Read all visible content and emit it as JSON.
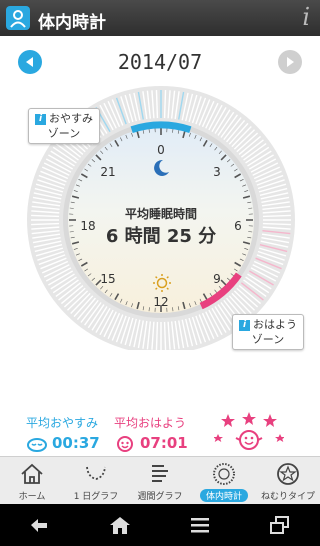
{
  "header": {
    "title": "体内時計",
    "info_glyph": "i"
  },
  "month": {
    "label": "2014/07"
  },
  "clock": {
    "hour_labels": [
      "0",
      "3",
      "6",
      "9",
      "12",
      "15",
      "18",
      "21"
    ],
    "center_title": "平均睡眠時間",
    "center_value": "6 時間 25 分",
    "sleep_zone_line1": "おやすみ",
    "sleep_zone_line2": "ゾーン",
    "wake_zone_line1": "おはよう",
    "wake_zone_line2": "ゾーン"
  },
  "stats": {
    "avg_sleep_label": "平均おやすみ",
    "avg_sleep_time": "00:37",
    "avg_wake_label": "平均おはよう",
    "avg_wake_time": "07:01"
  },
  "tabs": [
    {
      "label": "ホーム",
      "icon": "home-icon"
    },
    {
      "label": "1 日グラフ",
      "icon": "day-graph-icon"
    },
    {
      "label": "週間グラフ",
      "icon": "week-graph-icon"
    },
    {
      "label": "体内時計",
      "icon": "body-clock-icon",
      "active": true
    },
    {
      "label": "ねむりタイプ",
      "icon": "sleep-type-icon"
    }
  ],
  "colors": {
    "accent": "#2aa8e0",
    "wake": "#e8407f",
    "sleep": "#2aa8e0"
  }
}
